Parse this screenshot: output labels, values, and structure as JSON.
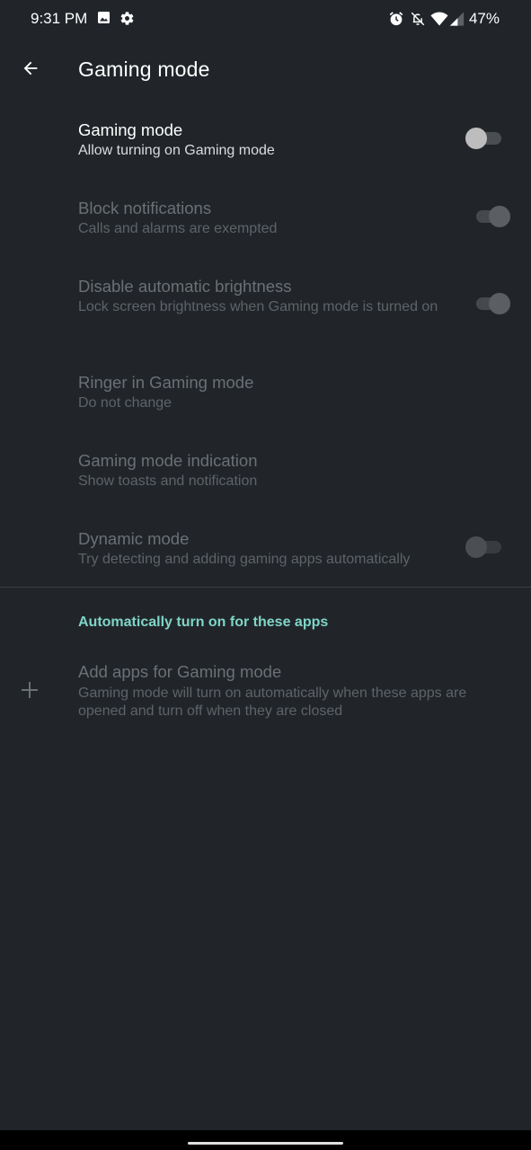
{
  "status_bar": {
    "time": "9:31 PM",
    "battery": "47%",
    "icons": [
      "image-icon",
      "settings-gear-icon",
      "alarm-icon",
      "notifications-off-icon",
      "wifi-icon",
      "signal-icon"
    ]
  },
  "app_bar": {
    "title": "Gaming mode",
    "back_icon": "arrow-back-icon"
  },
  "preferences": [
    {
      "title": "Gaming mode",
      "summary": "Allow turning on Gaming mode",
      "switch": "off",
      "enabled": true
    },
    {
      "title": "Block notifications",
      "summary": "Calls and alarms are exempted",
      "switch": "on",
      "enabled": false
    },
    {
      "title": "Disable automatic brightness",
      "summary": "Lock screen brightness when Gaming mode is turned on",
      "switch": "on",
      "enabled": false
    },
    {
      "title": "Ringer in Gaming mode",
      "summary": "Do not change",
      "enabled": false
    },
    {
      "title": "Gaming mode indication",
      "summary": "Show toasts and notification",
      "enabled": false
    },
    {
      "title": "Dynamic mode",
      "summary": "Try detecting and adding gaming apps automatically",
      "switch": "off",
      "enabled": false
    }
  ],
  "apps_section": {
    "header": "Automatically turn on for these apps",
    "add_item": {
      "icon": "plus-icon",
      "title": "Add apps for Gaming mode",
      "summary": "Gaming mode will turn on automatically when these apps are opened and turn off when they are closed"
    }
  },
  "colors": {
    "background": "#21252a",
    "accent": "#7fd5c7",
    "primary_text": "#ffffff",
    "disabled_text": "#6b7075"
  }
}
